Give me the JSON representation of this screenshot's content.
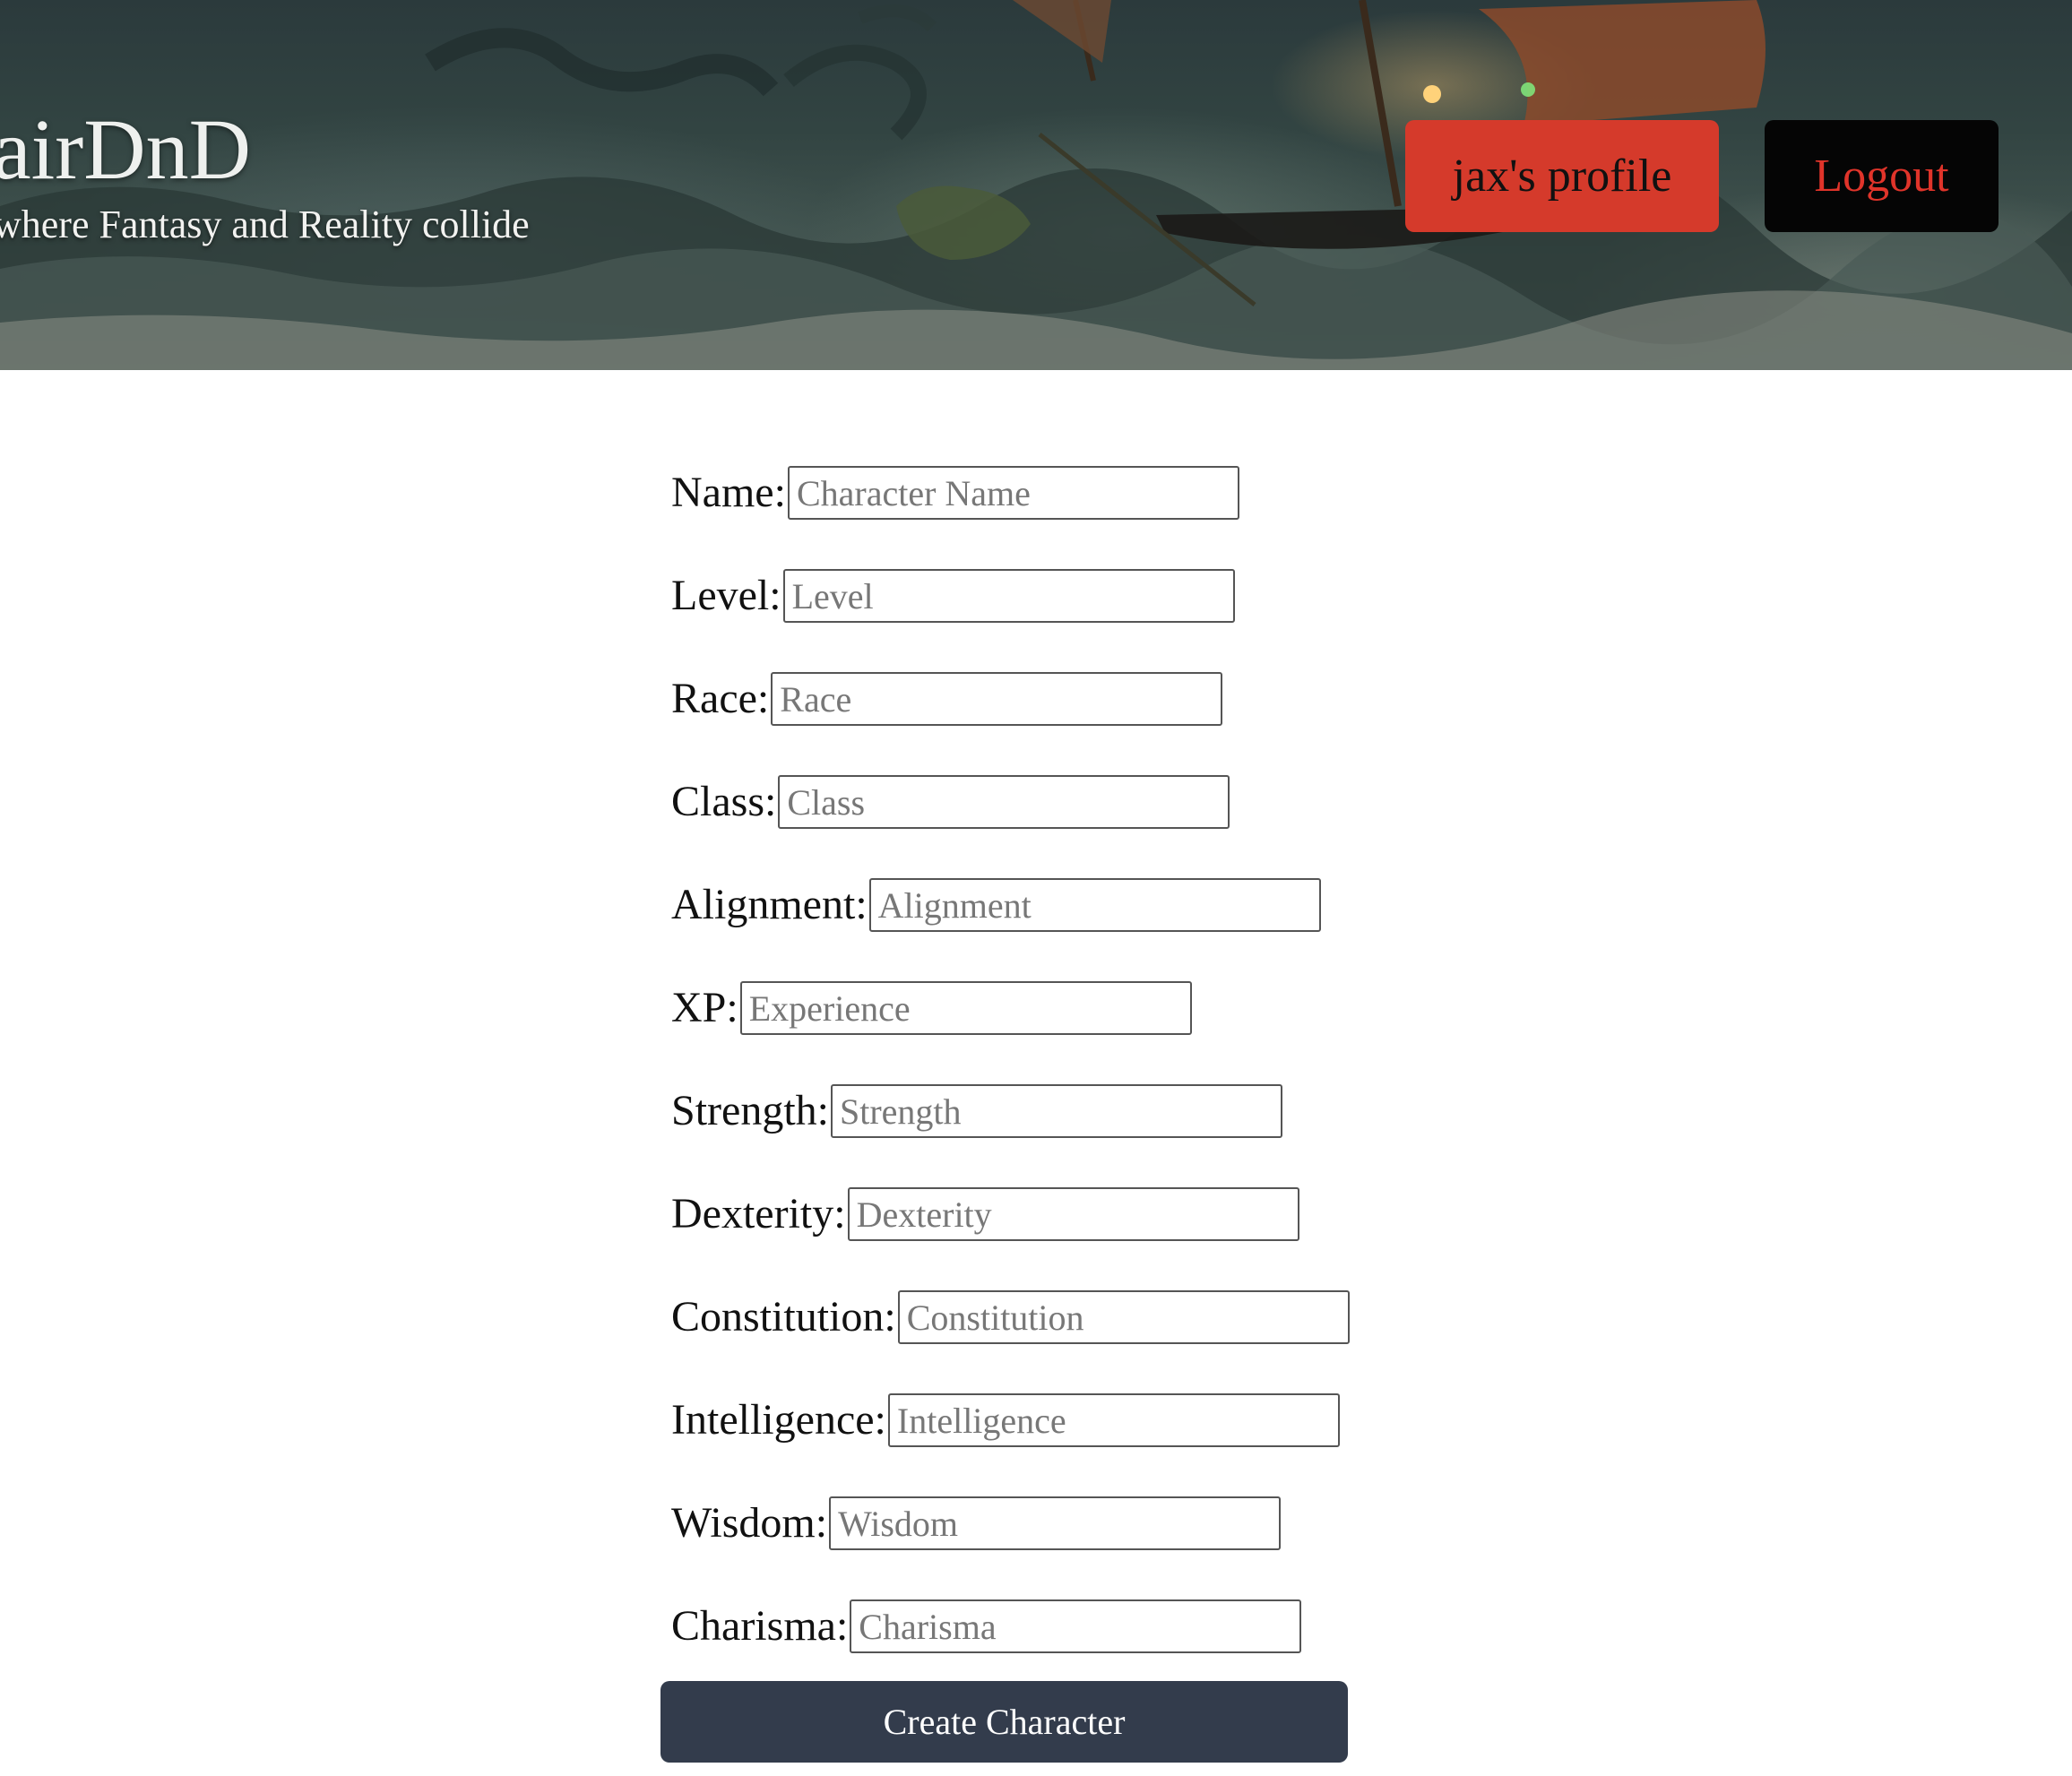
{
  "header": {
    "title": "airDnD",
    "tagline": "where Fantasy and Reality collide",
    "profile_button": "jax's profile",
    "logout_button": "Logout",
    "colors": {
      "profile_button_bg": "#d53a2b",
      "logout_button_bg": "#050505",
      "logout_text": "#e0342a"
    }
  },
  "form": {
    "fields": [
      {
        "label": "Name:",
        "placeholder": "Character Name"
      },
      {
        "label": "Level:",
        "placeholder": "Level"
      },
      {
        "label": "Race:",
        "placeholder": "Race"
      },
      {
        "label": "Class:",
        "placeholder": "Class"
      },
      {
        "label": "Alignment:",
        "placeholder": "Alignment"
      },
      {
        "label": "XP:",
        "placeholder": "Experience"
      },
      {
        "label": "Strength:",
        "placeholder": "Strength"
      },
      {
        "label": "Dexterity:",
        "placeholder": "Dexterity"
      },
      {
        "label": "Constitution:",
        "placeholder": "Constitution"
      },
      {
        "label": "Intelligence:",
        "placeholder": "Intelligence"
      },
      {
        "label": "Wisdom:",
        "placeholder": "Wisdom"
      },
      {
        "label": "Charisma:",
        "placeholder": "Charisma"
      }
    ],
    "submit_label": "Create Character",
    "submit_color": "#333c4c"
  }
}
